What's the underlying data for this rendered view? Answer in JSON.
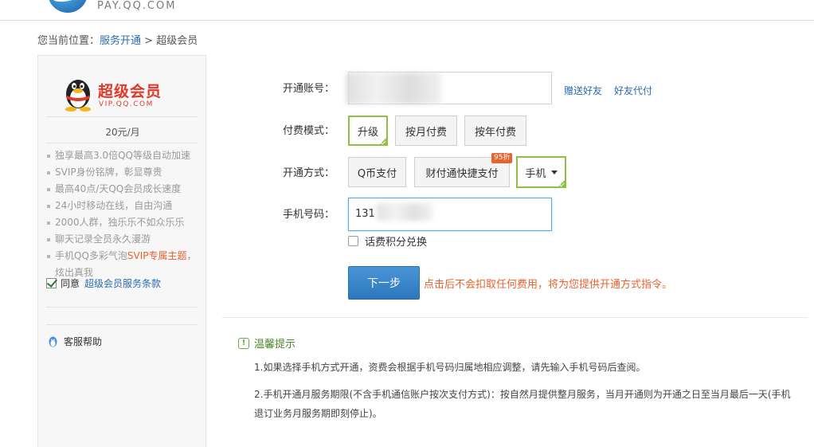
{
  "header": {
    "site": "PAY.QQ.COM"
  },
  "breadcrumb": {
    "prefix": "您当前位置：",
    "link": "服务开通",
    "sep": " > ",
    "current": "超级会员"
  },
  "sidebar": {
    "title": "超级会员",
    "site": "VIP.QQ.COM",
    "price": "20元/月",
    "features": [
      {
        "text": "独享最高3.0倍QQ等级自动加速"
      },
      {
        "text": "SVIP身份铭牌，彰显尊贵"
      },
      {
        "text": "最高40点/天QQ会员成长速度"
      },
      {
        "text": "24小时移动在线，自由沟通"
      },
      {
        "text": "2000人群，独乐乐不如众乐乐"
      },
      {
        "text": "聊天记录全员永久漫游"
      },
      {
        "pre": "手机QQ多彩气泡",
        "hl": "SVIP专属主题",
        "post": "，炫出真我"
      }
    ],
    "agree_text": "同意",
    "agree_link": "超级会员服务条款",
    "help": "客服帮助"
  },
  "form": {
    "account_label": "开通账号：",
    "gift_link": "赠送好友",
    "proxy_link": "好友代付",
    "pay_mode_label": "付费模式：",
    "pay_modes": [
      "升级",
      "按月付费",
      "按年付费"
    ],
    "method_label": "开通方式：",
    "methods": [
      "Q币支付",
      "财付通快捷支付",
      "手机"
    ],
    "method_badge": "95折",
    "phone_label": "手机号码：",
    "phone_value": "131",
    "points_label": "话费积分兑换",
    "next_button": "下一步",
    "next_note": "点击后不会扣取任何费用，将为您提供开通方式指令。"
  },
  "tips": {
    "title": "温馨提示",
    "items": [
      "1.如果选择手机方式开通，资费会根据手机号码归属地相应调整，请先输入手机号码后查阅。",
      "2.手机开通月服务期限(不含手机通信账户按次支付方式)：按自然月提供整月服务，当月开通则为开通之日至当月最后一天(手机",
      "退订业务月服务期即刻停止)。"
    ]
  },
  "colors": {
    "link": "#2b6cb0",
    "accent": "#e8622e",
    "selected": "#8fbf46",
    "primary": "#2d78bd"
  }
}
